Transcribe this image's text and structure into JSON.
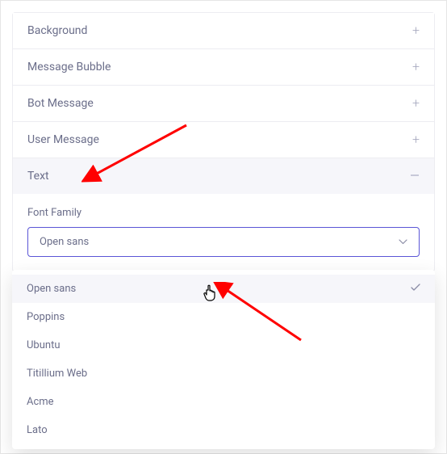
{
  "accordion": {
    "items": [
      {
        "label": "Background",
        "expanded": false
      },
      {
        "label": "Message Bubble",
        "expanded": false
      },
      {
        "label": "Bot Message",
        "expanded": false
      },
      {
        "label": "User Message",
        "expanded": false
      },
      {
        "label": "Text",
        "expanded": true
      }
    ]
  },
  "text_section": {
    "font_family_label": "Font Family",
    "selected_font": "Open sans",
    "options": [
      {
        "label": "Open sans",
        "selected": true
      },
      {
        "label": "Poppins",
        "selected": false
      },
      {
        "label": "Ubuntu",
        "selected": false
      },
      {
        "label": "Titillium Web",
        "selected": false
      },
      {
        "label": "Acme",
        "selected": false
      },
      {
        "label": "Lato",
        "selected": false
      }
    ]
  }
}
